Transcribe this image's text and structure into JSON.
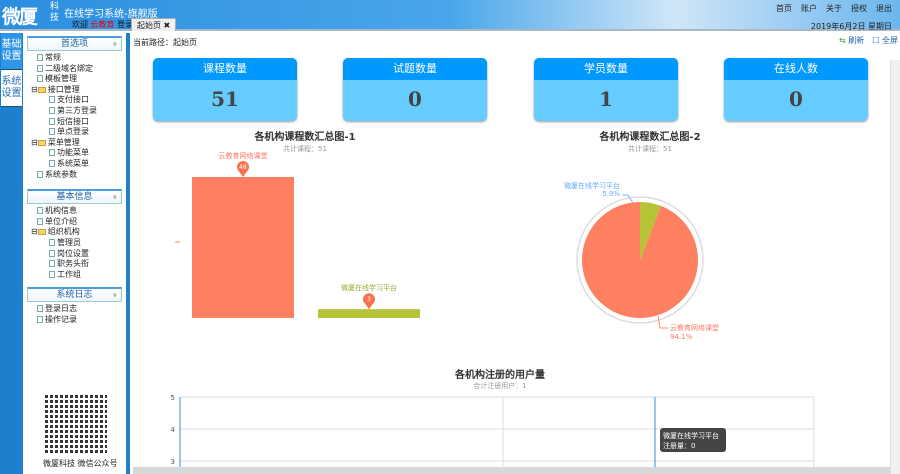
{
  "header": {
    "logo_text": "微厦",
    "logo_side": "科技",
    "title": "在线学习系统-旗舰版",
    "welcome": "欢迎",
    "username": "云教育",
    "logout": "登录",
    "tab": "起始页",
    "nav": [
      "首页",
      "账户",
      "关于",
      "授权",
      "退出"
    ],
    "date": "2019年6月2日 星期日"
  },
  "vtabs": [
    "基础设置",
    "系统设置"
  ],
  "sidebar": {
    "sections": [
      {
        "title": "首选项",
        "items": [
          {
            "label": "常规",
            "lvl": 1
          },
          {
            "label": "二级域名绑定",
            "lvl": 1
          },
          {
            "label": "模板管理",
            "lvl": 1
          },
          {
            "label": "接口管理",
            "lvl": 0,
            "folder": true
          },
          {
            "label": "支付接口",
            "lvl": 2
          },
          {
            "label": "第三方登录",
            "lvl": 2
          },
          {
            "label": "短信接口",
            "lvl": 2
          },
          {
            "label": "单点登录",
            "lvl": 2
          },
          {
            "label": "菜单管理",
            "lvl": 0,
            "folder": true
          },
          {
            "label": "功能菜单",
            "lvl": 2
          },
          {
            "label": "系统菜单",
            "lvl": 2
          },
          {
            "label": "系统参数",
            "lvl": 1
          }
        ]
      },
      {
        "title": "基本信息",
        "items": [
          {
            "label": "机构信息",
            "lvl": 1
          },
          {
            "label": "单位介绍",
            "lvl": 1
          },
          {
            "label": "组织机构",
            "lvl": 0,
            "folder": true
          },
          {
            "label": "管理员",
            "lvl": 2
          },
          {
            "label": "岗位设置",
            "lvl": 2
          },
          {
            "label": "职务头衔",
            "lvl": 2
          },
          {
            "label": "工作组",
            "lvl": 2
          }
        ]
      },
      {
        "title": "系统日志",
        "items": [
          {
            "label": "登录日志",
            "lvl": 1
          },
          {
            "label": "操作记录",
            "lvl": 1
          }
        ]
      }
    ],
    "qr_caption": "微厦科技 微信公众号"
  },
  "main": {
    "breadcrumb": "当前路径：起始页",
    "refresh": "刷新",
    "fullscreen": "全屏",
    "cards": [
      {
        "label": "课程数量",
        "value": "51"
      },
      {
        "label": "试题数量",
        "value": "0"
      },
      {
        "label": "学员数量",
        "value": "1"
      },
      {
        "label": "在线人数",
        "value": "0"
      }
    ]
  },
  "colors": {
    "orange": "#ff8060",
    "olive": "#b5c334",
    "blue": "#0099ff",
    "lightblue": "#66ccff"
  },
  "chart_data": [
    {
      "type": "bar",
      "title": "各机构课程数汇总图-1",
      "subtitle": "共计课程：51",
      "categories": [
        "云教育网络课堂",
        "微厦在线学习平台"
      ],
      "values": [
        48,
        3
      ],
      "colors": [
        "#ff8060",
        "#b5c334"
      ]
    },
    {
      "type": "pie",
      "title": "各机构课程数汇总图-2",
      "subtitle": "共计课程：51",
      "slices": [
        {
          "name": "云教育网络课堂",
          "value": 48,
          "pct": "94.1%"
        },
        {
          "name": "微厦在线学习平台",
          "value": 3,
          "pct": "5.9%"
        }
      ]
    },
    {
      "type": "line",
      "title": "各机构注册的用户量",
      "subtitle": "合计注册用户：1",
      "yticks": [
        "5",
        "4",
        "3"
      ],
      "tooltip": {
        "name": "微厦在线学习平台",
        "label": "注册量：0"
      }
    }
  ]
}
